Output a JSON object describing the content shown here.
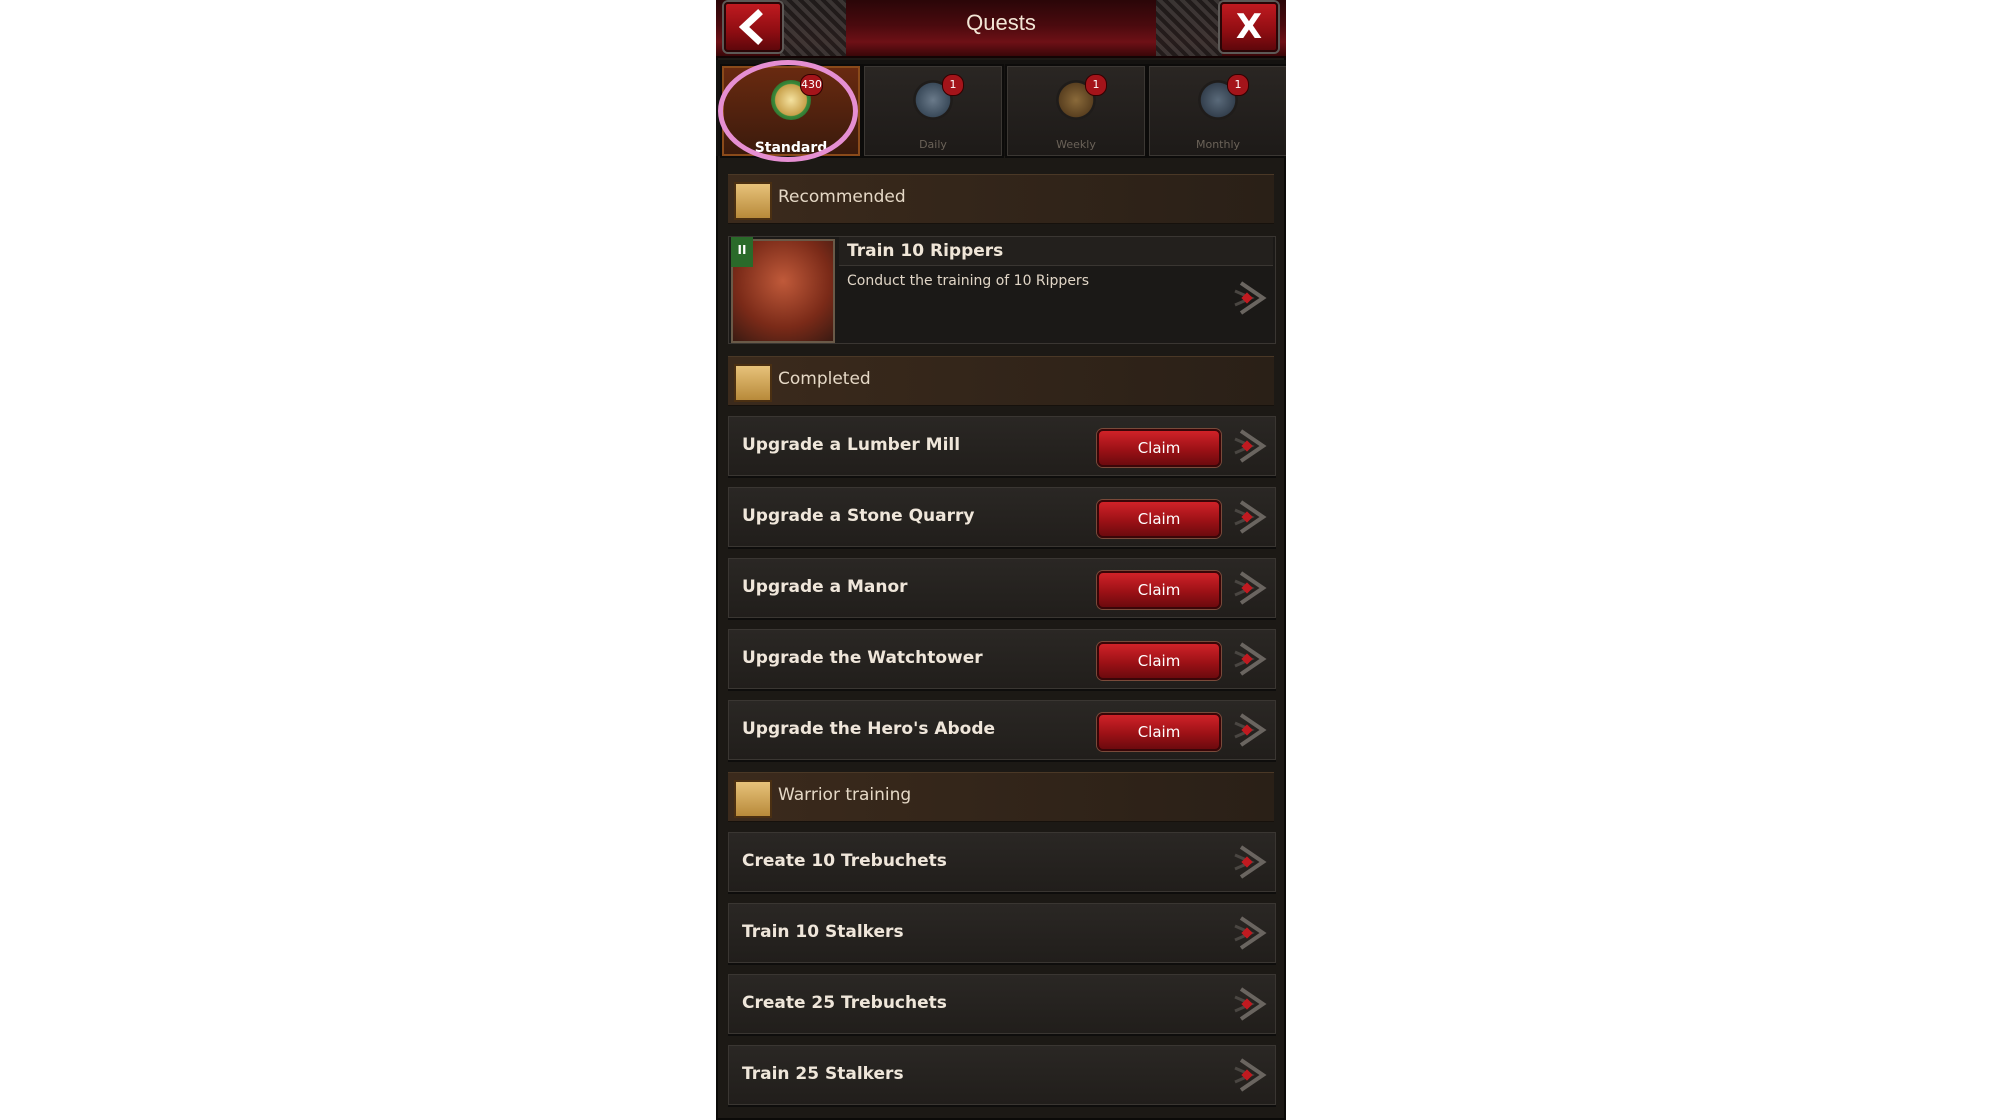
{
  "header": {
    "title": "Quests",
    "back_icon": "chevron-left",
    "close_label": "X"
  },
  "tabs": [
    {
      "label": "Standard",
      "badge": "430",
      "active": true
    },
    {
      "label": "Daily",
      "badge": "1",
      "active": false
    },
    {
      "label": "Weekly",
      "badge": "1",
      "active": false
    },
    {
      "label": "Monthly",
      "badge": "1",
      "active": false
    }
  ],
  "sections": {
    "recommended": "Recommended",
    "completed": "Completed",
    "warrior_training": "Warrior training"
  },
  "recommended_quest": {
    "flag": "II",
    "title": "Train 10 Rippers",
    "description": "Conduct the training of 10 Rippers"
  },
  "completed_quests": [
    {
      "title": "Upgrade a Lumber Mill",
      "button": "Claim"
    },
    {
      "title": "Upgrade a Stone Quarry",
      "button": "Claim"
    },
    {
      "title": "Upgrade a Manor",
      "button": "Claim"
    },
    {
      "title": "Upgrade the Watchtower",
      "button": "Claim"
    },
    {
      "title": "Upgrade the Hero's Abode",
      "button": "Claim"
    }
  ],
  "training_quests": [
    {
      "title": "Create 10 Trebuchets"
    },
    {
      "title": "Train 10 Stalkers"
    },
    {
      "title": "Create 25 Trebuchets"
    },
    {
      "title": "Train 25 Stalkers"
    }
  ],
  "colors": {
    "accent_red": "#a4141a",
    "panel": "#1c1915",
    "highlight_ring": "#e58fd2"
  }
}
